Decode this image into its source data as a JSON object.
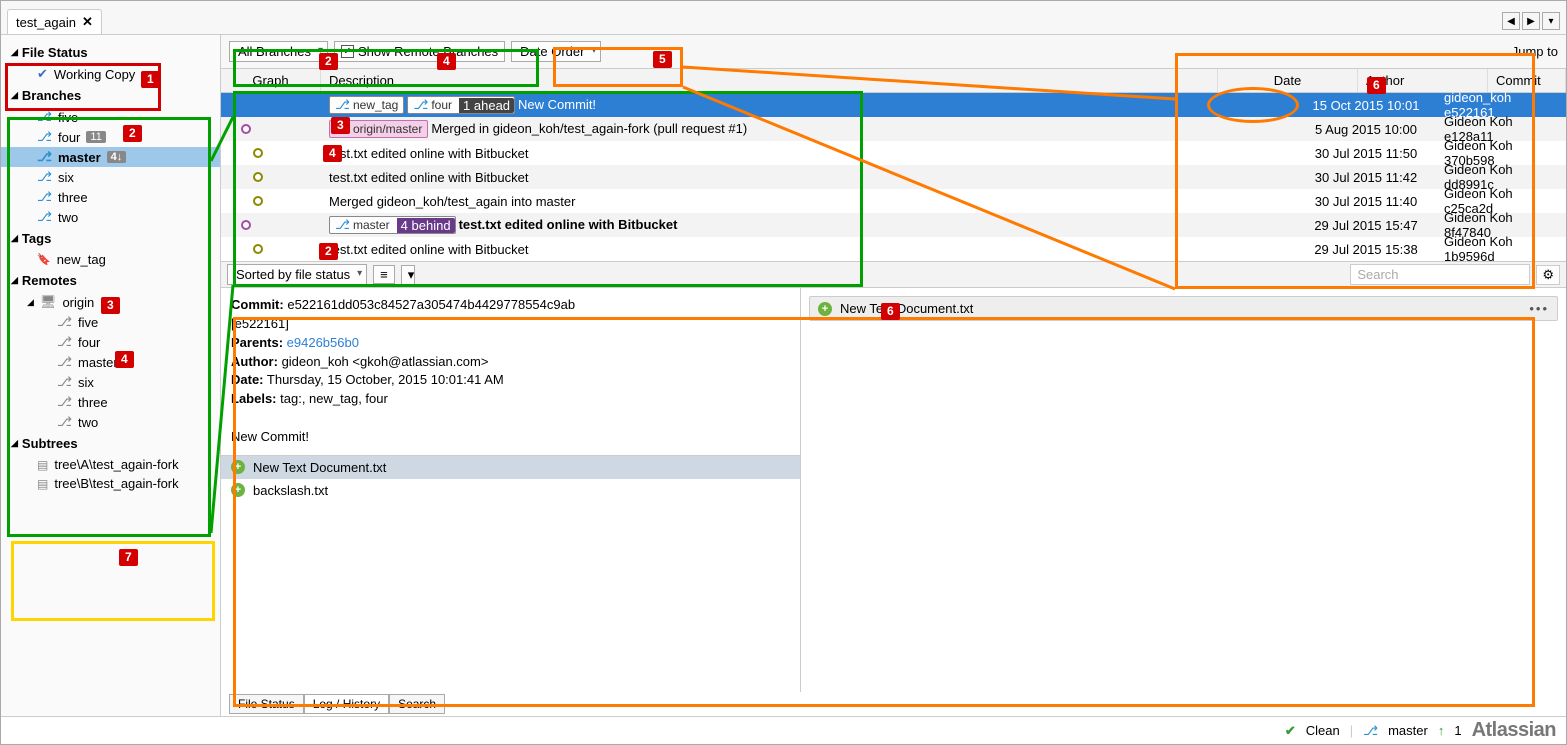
{
  "tab": {
    "name": "test_again"
  },
  "sidebar": {
    "file_status": {
      "header": "File Status",
      "working_copy": "Working Copy"
    },
    "branches": {
      "header": "Branches",
      "items": [
        {
          "label": "five"
        },
        {
          "label": "four",
          "badge": "11"
        },
        {
          "label": "master",
          "badge": "4↓",
          "active": true
        },
        {
          "label": "six"
        },
        {
          "label": "three"
        },
        {
          "label": "two"
        }
      ]
    },
    "tags": {
      "header": "Tags",
      "items": [
        {
          "label": "new_tag"
        }
      ]
    },
    "remotes": {
      "header": "Remotes",
      "origin": "origin",
      "items": [
        {
          "label": "five"
        },
        {
          "label": "four"
        },
        {
          "label": "master"
        },
        {
          "label": "six"
        },
        {
          "label": "three"
        },
        {
          "label": "two"
        }
      ]
    },
    "subtrees": {
      "header": "Subtrees",
      "items": [
        {
          "label": "tree\\A\\test_again-fork"
        },
        {
          "label": "tree\\B\\test_again-fork"
        }
      ]
    }
  },
  "toolbar": {
    "all_branches": "All Branches",
    "show_remote": "Show Remote Branches",
    "date_order": "Date Order",
    "jump_to": "Jump to"
  },
  "columns": {
    "graph": "Graph",
    "desc": "Description",
    "date": "Date",
    "author": "Author",
    "commit": "Commit"
  },
  "commits": [
    {
      "pills": [
        {
          "text": "new_tag"
        },
        {
          "text": "four",
          "sub": "1 ahead"
        }
      ],
      "desc": "New Commit!",
      "date": "15 Oct 2015 10:01",
      "author": "gideon_koh <gkoh",
      "hash": "e522161",
      "selected": true,
      "node": "blue",
      "offset": 0
    },
    {
      "pills": [
        {
          "text": "origin/master",
          "pink": true
        }
      ],
      "desc": "Merged in gideon_koh/test_again-fork (pull request #1)",
      "date": "5 Aug 2015 10:00",
      "author": "Gideon Koh <gkoh",
      "hash": "e128a11",
      "node": "purple",
      "offset": 12
    },
    {
      "desc": "test.txt edited online with Bitbucket",
      "date": "30 Jul 2015 11:50",
      "author": "Gideon Koh <gkoh",
      "hash": "370b598",
      "node": "olive",
      "offset": 24
    },
    {
      "desc": "test.txt edited online with Bitbucket",
      "date": "30 Jul 2015 11:42",
      "author": "Gideon Koh <gkoh",
      "hash": "dd8991c",
      "node": "olive",
      "offset": 24
    },
    {
      "desc": "Merged gideon_koh/test_again into master",
      "date": "30 Jul 2015 11:40",
      "author": "Gideon Koh <gkoh",
      "hash": "c25ca2d",
      "node": "olive",
      "offset": 24
    },
    {
      "pills": [
        {
          "text": "master",
          "sub": "4 behind",
          "subpurple": true
        }
      ],
      "desc": "test.txt edited online with Bitbucket",
      "date": "29 Jul 2015 15:47",
      "author": "Gideon Koh <gkoh",
      "hash": "8f47840",
      "bold": true,
      "node": "purple",
      "offset": 12
    },
    {
      "desc": "test.txt edited online with Bitbucket",
      "date": "29 Jul 2015 15:38",
      "author": "Gideon Koh <gkoh",
      "hash": "1b9596d",
      "node": "olive",
      "offset": 24
    }
  ],
  "sortbar": {
    "sorted": "Sorted by file status",
    "search_placeholder": "Search"
  },
  "detail": {
    "commit_label": "Commit:",
    "commit_full": "e522161dd053c84527a305474b4429778554c9ab",
    "short": "[e522161]",
    "parents_label": "Parents:",
    "parents": "e9426b56b0",
    "author_label": "Author:",
    "author": "gideon_koh <gkoh@atlassian.com>",
    "date_label": "Date:",
    "date": "Thursday, 15 October, 2015 10:01:41 AM",
    "labels_label": "Labels:",
    "labels": "tag:, new_tag, four",
    "message": "New Commit!",
    "files": [
      {
        "name": "New Text Document.txt",
        "selected": true
      },
      {
        "name": "backslash.txt"
      }
    ],
    "right_file": "New Text Document.txt"
  },
  "bottom_tabs": {
    "file_status": "File Status",
    "log": "Log / History",
    "search": "Search"
  },
  "status": {
    "clean": "Clean",
    "branch": "master",
    "ahead": "1",
    "brand": "Atlassian"
  },
  "callouts": {
    "c1": "1",
    "c2": "2",
    "c3": "3",
    "c4": "4",
    "c5": "5",
    "c6": "6",
    "c7": "7"
  }
}
